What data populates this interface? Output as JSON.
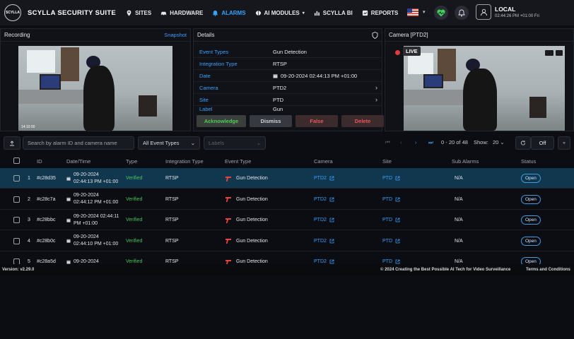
{
  "brand": {
    "logo_text": "SCYLLA",
    "title": "SCYLLA SECURITY SUITE"
  },
  "nav": [
    {
      "label": "SITES",
      "icon": "map-pin-icon"
    },
    {
      "label": "HARDWARE",
      "icon": "car-icon"
    },
    {
      "label": "ALARMS",
      "icon": "bell-icon",
      "active": true
    },
    {
      "label": "AI MODULES",
      "icon": "brain-icon"
    },
    {
      "label": "SCYLLA BI",
      "icon": "bar-chart-icon"
    },
    {
      "label": "REPORTS",
      "icon": "report-icon"
    }
  ],
  "user": {
    "name": "LOCAL",
    "time": "02:44:26 PM +01:00 Fri"
  },
  "recording_panel": {
    "title": "Recording",
    "snapshot_label": "Snapshot"
  },
  "details_panel": {
    "title": "Details",
    "rows": [
      {
        "label": "Event Types",
        "value": "Gun Detection"
      },
      {
        "label": "Integration Type",
        "value": "RTSP"
      },
      {
        "label": "Date",
        "value": "09-20-2024 02:44:13 PM +01:00"
      },
      {
        "label": "Camera",
        "value": "PTD2"
      },
      {
        "label": "Site",
        "value": "PTD"
      },
      {
        "label": "Label",
        "value": "Gun"
      }
    ],
    "buttons": {
      "acknowledge": "Acknowledge",
      "dismiss": "Dismiss",
      "false": "False",
      "delete": "Delete"
    }
  },
  "camera_panel": {
    "title": "Camera [PTD2]",
    "live_label": "LIVE"
  },
  "filters": {
    "search_placeholder": "Search by alarm ID and camera name",
    "event_types": "All Event Types",
    "labels_placeholder": "Labels",
    "range": "0 - 20 of 48",
    "show_label": "Show:",
    "show_value": "20",
    "toggle_label": "Off"
  },
  "table": {
    "headers": [
      "ID",
      "Date/Time",
      "Type",
      "Integration Type",
      "Event Type",
      "Camera",
      "Site",
      "Sub Alarms",
      "Status"
    ],
    "rows": [
      {
        "num": "1",
        "id": "#c28d35",
        "date": "09-20-2024",
        "time": "02:44:13 PM +01:00",
        "type": "Verified",
        "integration": "RTSP",
        "event": "Gun Detection",
        "camera": "PTD2",
        "site": "PTD",
        "sub": "N/A",
        "status": "Open"
      },
      {
        "num": "2",
        "id": "#c28c7a",
        "date": "09-20-2024",
        "time": "02:44:12 PM +01:00",
        "type": "Verified",
        "integration": "RTSP",
        "event": "Gun Detection",
        "camera": "PTD2",
        "site": "PTD",
        "sub": "N/A",
        "status": "Open"
      },
      {
        "num": "3",
        "id": "#c28bbc",
        "date": "09-20-2024 02:44:11",
        "time": "PM +01:00",
        "type": "Verified",
        "integration": "RTSP",
        "event": "Gun Detection",
        "camera": "PTD2",
        "site": "PTD",
        "sub": "N/A",
        "status": "Open"
      },
      {
        "num": "4",
        "id": "#c28b0c",
        "date": "09-20-2024",
        "time": "02:44:10 PM +01:00",
        "type": "Verified",
        "integration": "RTSP",
        "event": "Gun Detection",
        "camera": "PTD2",
        "site": "PTD",
        "sub": "N/A",
        "status": "Open"
      },
      {
        "num": "5",
        "id": "#c28a5d",
        "date": "09-20-2024",
        "time": "",
        "type": "Verified",
        "integration": "RTSP",
        "event": "Gun Detection",
        "camera": "PTD2",
        "site": "PTD",
        "sub": "N/A",
        "status": "Open"
      }
    ]
  },
  "footer": {
    "version": "Version: v2.29.0",
    "tagline": "© 2024 Creating the Best Possible AI Tech for Video Surveillance",
    "terms": "Terms and Conditions"
  },
  "colors": {
    "accent": "#33a4ff",
    "verified": "#47c35a",
    "danger": "#ea5656",
    "selected_row": "#11374f"
  }
}
